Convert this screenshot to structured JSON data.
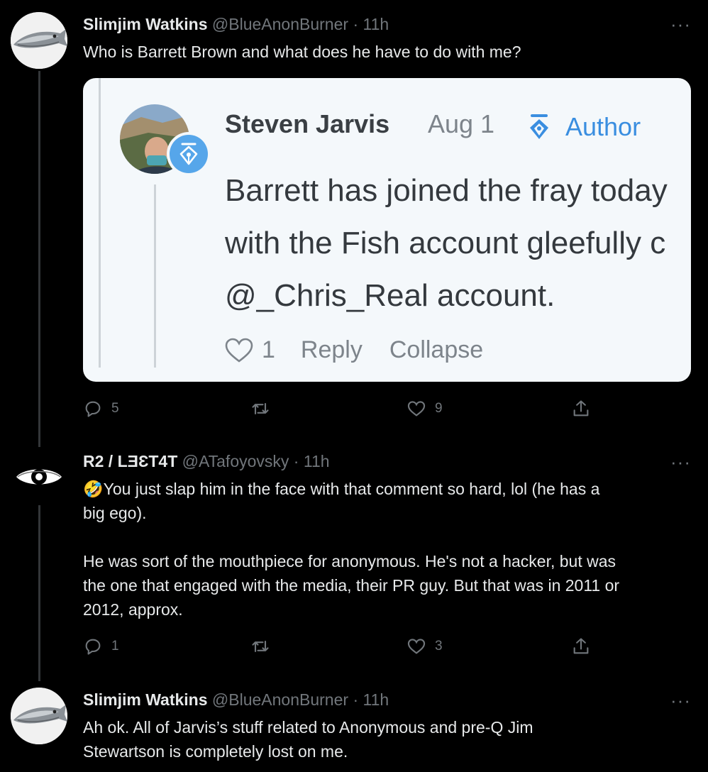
{
  "tweets": [
    {
      "name": "Slimjim Watkins",
      "handle": "@BlueAnonBurner",
      "dot": "·",
      "time": "11h",
      "text": "Who is Barrett Brown and what does he have to do with me?",
      "reply_count": "5",
      "retweet_count": "",
      "like_count": "9"
    },
    {
      "name": "R2 / LƎƐT4T",
      "handle": "@ATafoyovsky",
      "dot": "·",
      "time": "11h",
      "text": "🤣You just slap him in the face with that comment so hard, lol (he has a\nbig ego).\n\nHe was sort of the mouthpiece for anonymous. He's not a hacker, but was\nthe one that engaged with the media, their PR guy. But that was in 2011 or\n2012, approx.",
      "reply_count": "1",
      "retweet_count": "",
      "like_count": "3"
    },
    {
      "name": "Slimjim Watkins",
      "handle": "@BlueAnonBurner",
      "dot": "·",
      "time": "11h",
      "text": "Ah ok. All of Jarvis’s stuff related to Anonymous and pre-Q Jim\nStewartson is completely lost on me."
    }
  ],
  "more_label": "···",
  "embedded_screenshot": {
    "name": "Steven Jarvis",
    "date": "Aug 1",
    "badge_label": "Author",
    "body": "Barrett has joined the fray today\nwith the Fish account gleefully c\n@_Chris_Real account.",
    "like_count": "1",
    "reply_label": "Reply",
    "collapse_label": "Collapse"
  },
  "icons": {
    "reply": "reply-bubble-icon",
    "retweet": "retweet-icon",
    "like": "heart-icon",
    "share": "share-icon",
    "author_badge": "pen-nib-icon"
  },
  "colors": {
    "background": "#000000",
    "text": "#e7e9ea",
    "muted": "#71767b",
    "card_bg": "#f4f8fb",
    "author_blue": "#3a8ee0"
  }
}
